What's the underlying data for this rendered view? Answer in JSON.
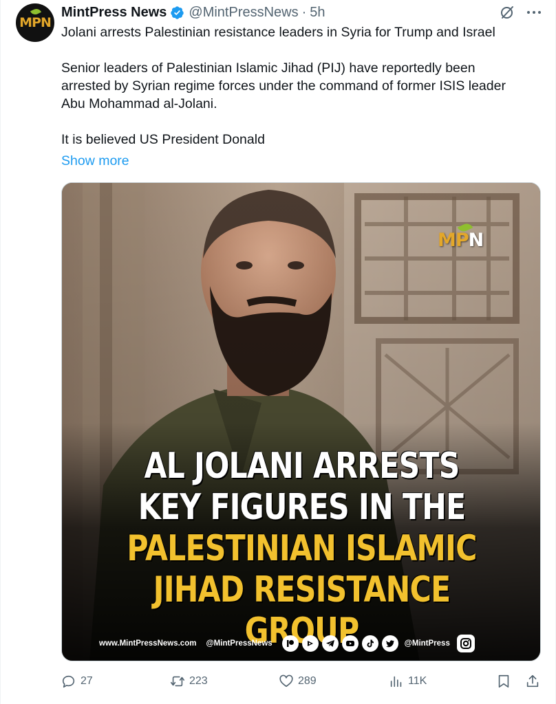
{
  "author": {
    "avatar_logo": "MPN",
    "name": "MintPress News",
    "handle": "@MintPressNews",
    "separator": "·",
    "time": "5h"
  },
  "tweet": {
    "title_line": "Jolani arrests Palestinian resistance leaders in Syria for Trump and Israel",
    "paragraph_1": "Senior leaders of Palestinian Islamic Jihad (PIJ) have reportedly been\narrested by Syrian regime forces under the command of former ISIS leader\nAbu Mohammad al-Jolani.",
    "paragraph_2": "It is believed US President Donald",
    "show_more": "Show more"
  },
  "media": {
    "badge": {
      "m": "M",
      "p": "P",
      "n": "N"
    },
    "headline": {
      "line1": "AL JOLANI ARRESTS",
      "line2": "KEY FIGURES IN THE",
      "line3": "PALESTINIAN ISLAMIC",
      "line4": "JIHAD RESISTANCE GROUP"
    },
    "footer": {
      "site": "www.MintPressNews.com",
      "handle": "@MintPressNews",
      "social_icons": [
        "patreon-icon",
        "rumble-icon",
        "telegram-icon",
        "youtube-icon",
        "tiktok-icon",
        "twitter-icon"
      ],
      "secondary_handle": "@MintPress",
      "instagram_icon": "instagram-icon"
    },
    "colors": {
      "headline_white": "#ffffff",
      "headline_gold": "#f2c12e",
      "badge_gold": "#e3a72a"
    }
  },
  "actions": {
    "replies": "27",
    "reposts": "223",
    "likes": "289",
    "views": "11K"
  },
  "icons": {
    "verified": "verified-badge-icon",
    "grok": "grok-icon",
    "more": "more-icon",
    "reply": "reply-icon",
    "repost": "repost-icon",
    "like": "heart-icon",
    "views": "views-icon",
    "bookmark": "bookmark-icon",
    "share": "share-icon"
  },
  "colors": {
    "link": "#1d9bf0",
    "secondary_text": "#536471",
    "verified": "#1d9bf0"
  }
}
